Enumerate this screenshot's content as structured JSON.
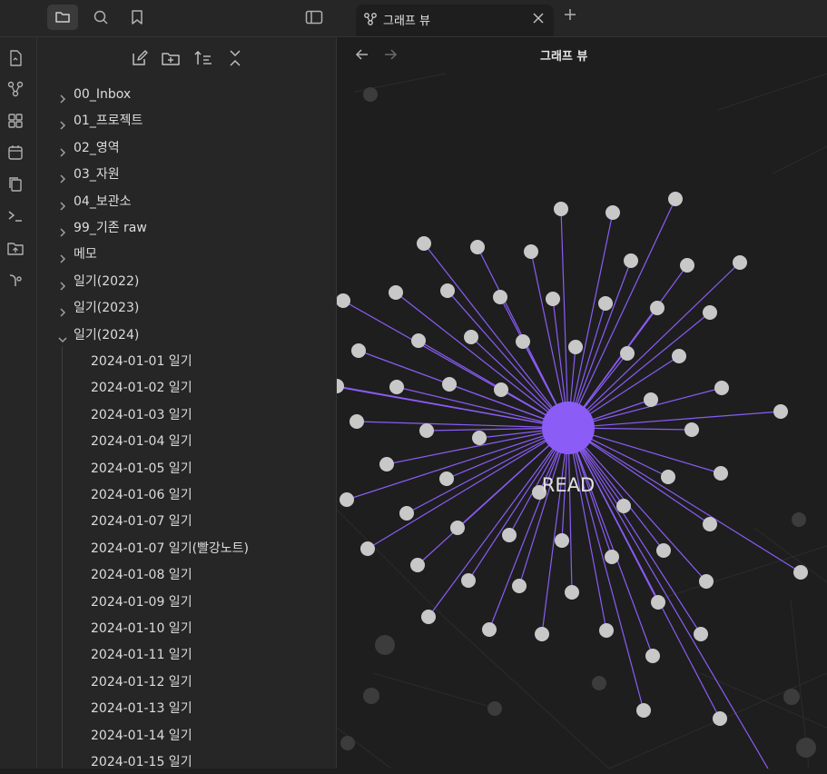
{
  "tab": {
    "title": "그래프 뷰"
  },
  "view": {
    "title": "그래프 뷰"
  },
  "file_tree": {
    "folders": [
      "00_Inbox",
      "01_프로젝트",
      "02_영역",
      "03_자원",
      "04_보관소",
      "99_기존 raw",
      "메모",
      "일기(2022)",
      "일기(2023)"
    ],
    "open_folder": "일기(2024)",
    "files": [
      "2024-01-01 일기",
      "2024-01-02 일기",
      "2024-01-03 일기",
      "2024-01-04 일기",
      "2024-01-05 일기",
      "2024-01-06 일기",
      "2024-01-07 일기",
      "2024-01-07 일기(빨강노트)",
      "2024-01-08 일기",
      "2024-01-09 일기",
      "2024-01-10 일기",
      "2024-01-11 일기",
      "2024-01-12 일기",
      "2024-01-13 일기",
      "2024-01-14 일기",
      "2024-01-15 일기"
    ]
  },
  "graph": {
    "center_label": "READ",
    "accent_color": "#8b5cf6",
    "node_color": "#c8c8c8",
    "dim_node_color": "#3c3c3c"
  },
  "icons": {
    "titlebar": [
      "folder-icon",
      "search-icon",
      "bookmark-icon",
      "sidebar-toggle-icon"
    ],
    "ribbon": [
      "file-switcher-icon",
      "graph-icon",
      "canvas-icon",
      "calendar-icon",
      "templates-icon",
      "command-icon",
      "upload-icon",
      "git-icon"
    ],
    "nav": [
      "new-note-icon",
      "new-folder-icon",
      "sort-icon",
      "collapse-icon"
    ]
  }
}
